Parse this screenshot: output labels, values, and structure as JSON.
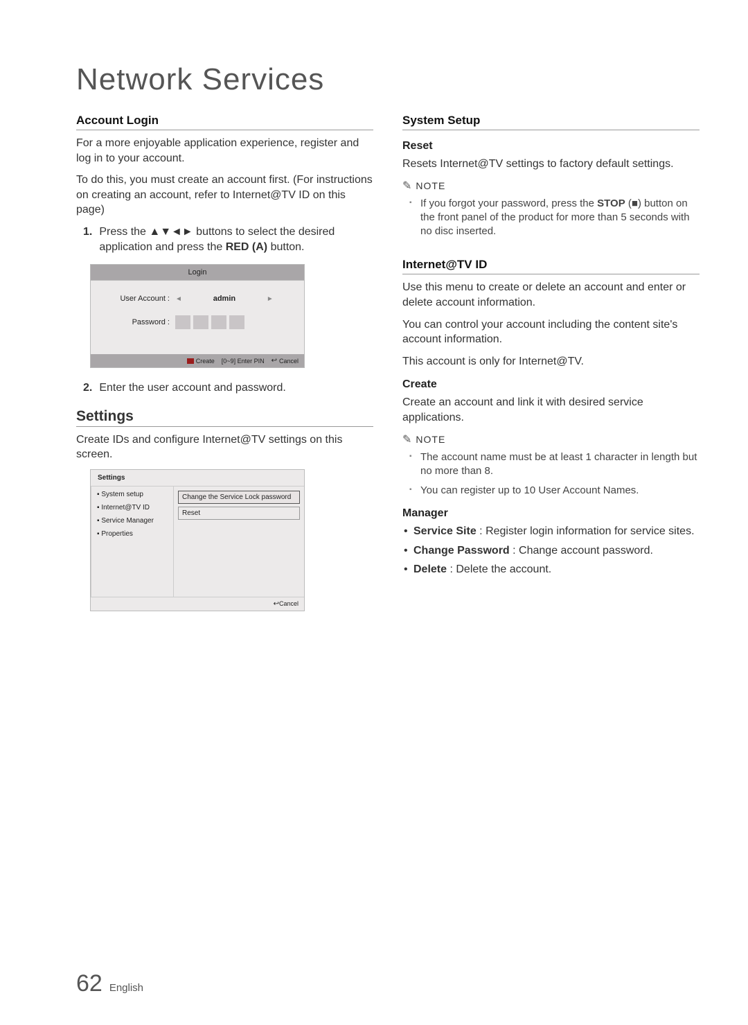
{
  "chapter": "Network Services",
  "left": {
    "h_account_login": "Account Login",
    "p1": "For a more enjoyable application experience, register and log in to your account.",
    "p2": "To do this, you must create an account first. (For instructions on creating an account, refer to Internet@TV ID on this page)",
    "step1_num": "1.",
    "step1_a": "Press the ",
    "step1_btns": "▲▼◄►",
    "step1_b": " buttons to select the desired application and press the ",
    "step1_red": "RED (A)",
    "step1_c": " button.",
    "login_ui": {
      "title": "Login",
      "user_label": "User Account :",
      "user_value": "admin",
      "pw_label": "Password :",
      "footer_create": "Create",
      "footer_pin": "[0~9] Enter PIN",
      "footer_cancel": "Cancel"
    },
    "step2_num": "2.",
    "step2": "Enter the user account and password.",
    "h_settings": "Settings",
    "p_settings": "Create IDs and configure Internet@TV settings on this screen.",
    "settings_ui": {
      "hdr": "Settings",
      "side": [
        "▪ System setup",
        "▪ Internet@TV ID",
        "▪ Service Manager",
        "▪ Properties"
      ],
      "opt1": "Change the Service Lock password",
      "opt2": "Reset",
      "ftr_cancel": "Cancel"
    }
  },
  "right": {
    "h_system_setup": "System Setup",
    "h_reset": "Reset",
    "p_reset": "Resets Internet@TV settings to factory default settings.",
    "note_label": "NOTE",
    "note1_a": "If you forgot your password, press the ",
    "note1_stop": "STOP",
    "note1_b": " (",
    "note1_sym": "■",
    "note1_c": ") button on the front panel of the product for more than 5 seconds with no disc inserted.",
    "h_itvid": "Internet@TV ID",
    "p_itvid1": "Use this menu to create or delete an account and enter or delete account information.",
    "p_itvid2": "You can control your account including the content site's account information.",
    "p_itvid3": "This account is only for Internet@TV.",
    "h_create": "Create",
    "p_create": "Create an account and link it with desired service applications.",
    "note2_1": "The account name must be at least 1 character in length but no more than 8.",
    "note2_2": "You can register up to 10 User Account Names.",
    "h_manager": "Manager",
    "mgr_service_bold": "Service Site",
    "mgr_service_rest": " : Register login information for service sites.",
    "mgr_change_bold": "Change Password",
    "mgr_change_rest": " : Change account password.",
    "mgr_delete_bold": "Delete",
    "mgr_delete_rest": " : Delete the account."
  },
  "footer": {
    "page": "62",
    "lang": "English"
  }
}
